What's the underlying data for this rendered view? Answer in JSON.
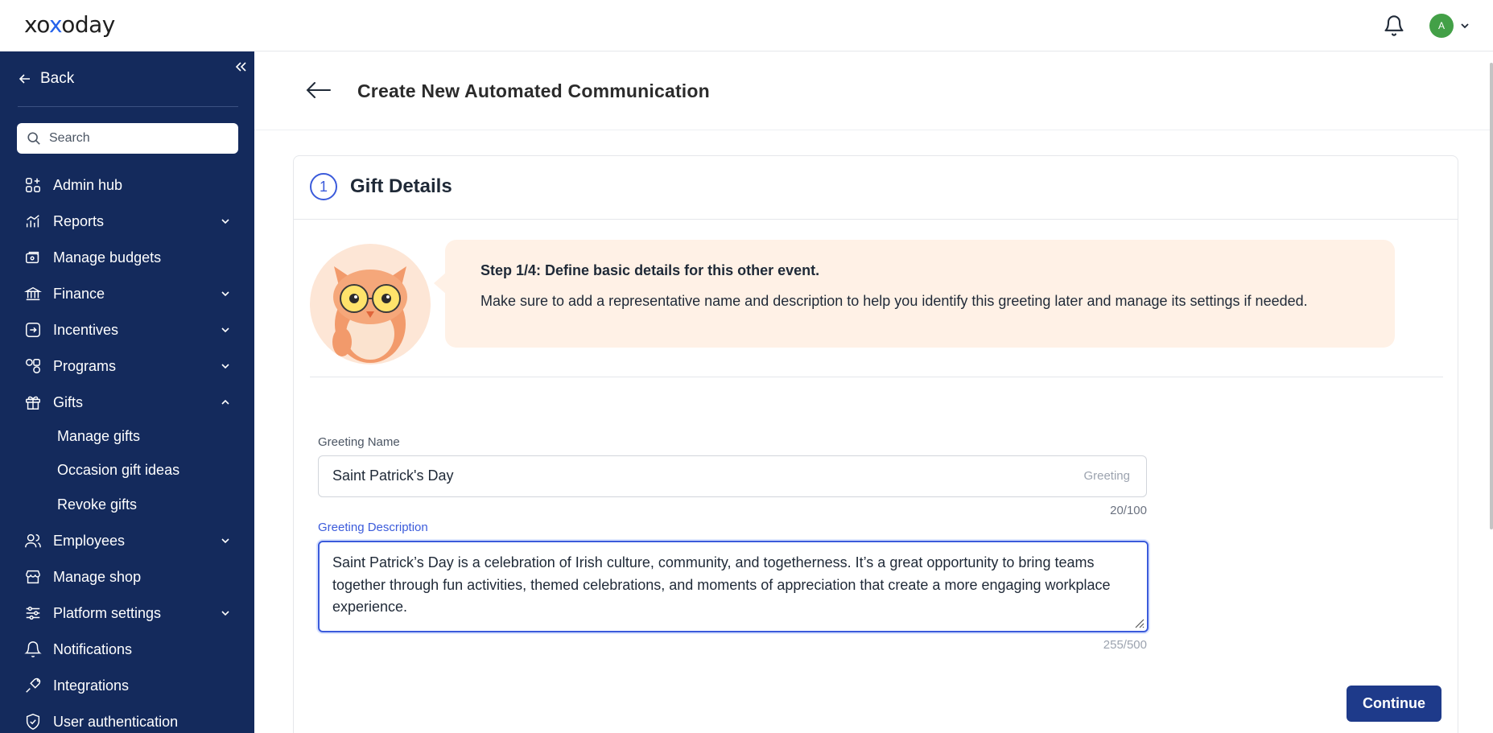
{
  "header": {
    "logo_text": "xoxoday",
    "avatar_initial": "A"
  },
  "sidebar": {
    "back_label": "Back",
    "search_placeholder": "Search",
    "items": [
      {
        "label": "Admin hub",
        "icon": "grid-icon"
      },
      {
        "label": "Reports",
        "icon": "chart-icon",
        "expandable": true
      },
      {
        "label": "Manage budgets",
        "icon": "budget-icon"
      },
      {
        "label": "Finance",
        "icon": "bank-icon",
        "expandable": true
      },
      {
        "label": "Incentives",
        "icon": "incentive-icon",
        "expandable": true
      },
      {
        "label": "Programs",
        "icon": "programs-icon",
        "expandable": true
      },
      {
        "label": "Gifts",
        "icon": "gift-icon",
        "expandable": true,
        "expanded": true
      },
      {
        "label": "Employees",
        "icon": "users-icon",
        "expandable": true
      },
      {
        "label": "Manage shop",
        "icon": "shop-icon"
      },
      {
        "label": "Platform settings",
        "icon": "sliders-icon",
        "expandable": true
      },
      {
        "label": "Notifications",
        "icon": "bell-icon"
      },
      {
        "label": "Integrations",
        "icon": "plug-icon"
      },
      {
        "label": "User authentication",
        "icon": "shield-icon"
      }
    ],
    "gifts_subitems": [
      "Manage gifts",
      "Occasion gift ideas",
      "Revoke gifts"
    ]
  },
  "page": {
    "title": "Create New Automated Communication"
  },
  "card": {
    "step_number": "1",
    "title": "Gift Details",
    "info_title": "Step 1/4: Define basic details for this other event.",
    "info_text": "Make sure to add a representative name and description to help you identify this greeting later and manage its settings if needed."
  },
  "form": {
    "name_label": "Greeting Name",
    "name_value": "Saint Patrick's Day",
    "name_suffix": "Greeting",
    "name_counter": "20/100",
    "desc_label": "Greeting Description",
    "desc_value": "Saint Patrick’s Day is a celebration of Irish culture, community, and togetherness. It’s a great opportunity to bring teams together through fun activities, themed celebrations, and moments of appreciation that create a more engaging workplace experience.",
    "desc_counter": "255/500",
    "continue_label": "Continue"
  },
  "colors": {
    "sidebar_bg": "#142a5c",
    "accent": "#3b5bdb",
    "button_bg": "#1e3a8a",
    "info_bg": "#fff1e6",
    "avatar_bg": "#43a047"
  }
}
